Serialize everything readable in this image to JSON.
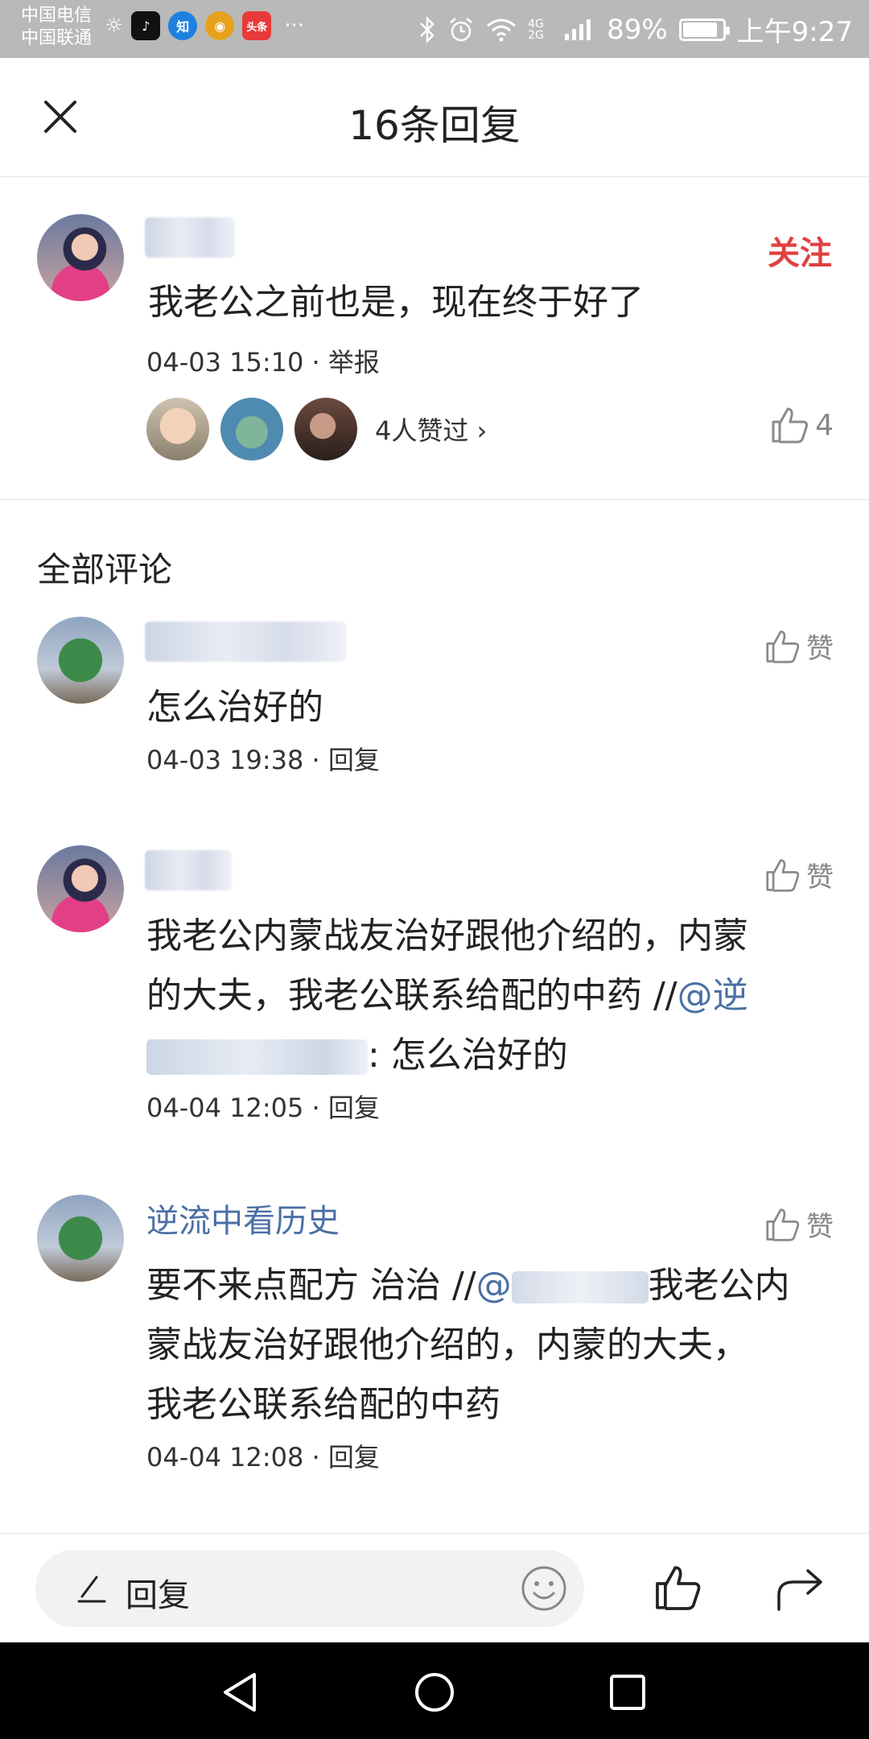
{
  "status_bar": {
    "carrier1": "中国电信",
    "carrier2": "中国联通",
    "apps": [
      {
        "name": "douyin-icon",
        "glyph": "♪",
        "color": "#111111"
      },
      {
        "name": "zhihu-icon",
        "glyph": "知",
        "color": "#1e80e0"
      },
      {
        "name": "weibo-icon",
        "glyph": "◉",
        "color": "#e6a21c"
      },
      {
        "name": "toutiao-icon",
        "glyph": "头条",
        "color": "#e83a3a"
      }
    ],
    "more": "···",
    "network": "4G 2G",
    "battery_pct": "89%",
    "battery_level": 0.89,
    "time": "上午9:27"
  },
  "sheet": {
    "title": "16条回复",
    "close_icon": "close-icon"
  },
  "main_post": {
    "follow_label": "关注",
    "text": "我老公之前也是，现在终于好了",
    "meta": "04-03 15:10 · 举报",
    "likers_label": "4人赞过 ›",
    "like_count": "4"
  },
  "section": {
    "title": "全部评论"
  },
  "comments": [
    {
      "like_label": "赞",
      "text": "怎么治好的",
      "meta": "04-03 19:38 · 回复"
    },
    {
      "like_label": "赞",
      "text_line1": "我老公内蒙战友治好跟他介绍的，内蒙",
      "text_line2_prefix": "的大夫，我老公联系给配的中药 //",
      "mention_prefix": "@逆",
      "text_line3_suffix": ": 怎么治好的",
      "meta": "04-04 12:05 · 回复"
    },
    {
      "author": "逆流中看历史",
      "like_label": "赞",
      "text_line1_prefix": "要不来点配方 治治 //",
      "mention_prefix": "@",
      "text_line1_suffix": "我老公内",
      "text_line2": "蒙战友治好跟他介绍的，内蒙的大夫，",
      "text_line3": "我老公联系给配的中药",
      "meta": "04-04 12:08 · 回复"
    }
  ],
  "bottom_bar": {
    "reply_placeholder": "回复"
  }
}
